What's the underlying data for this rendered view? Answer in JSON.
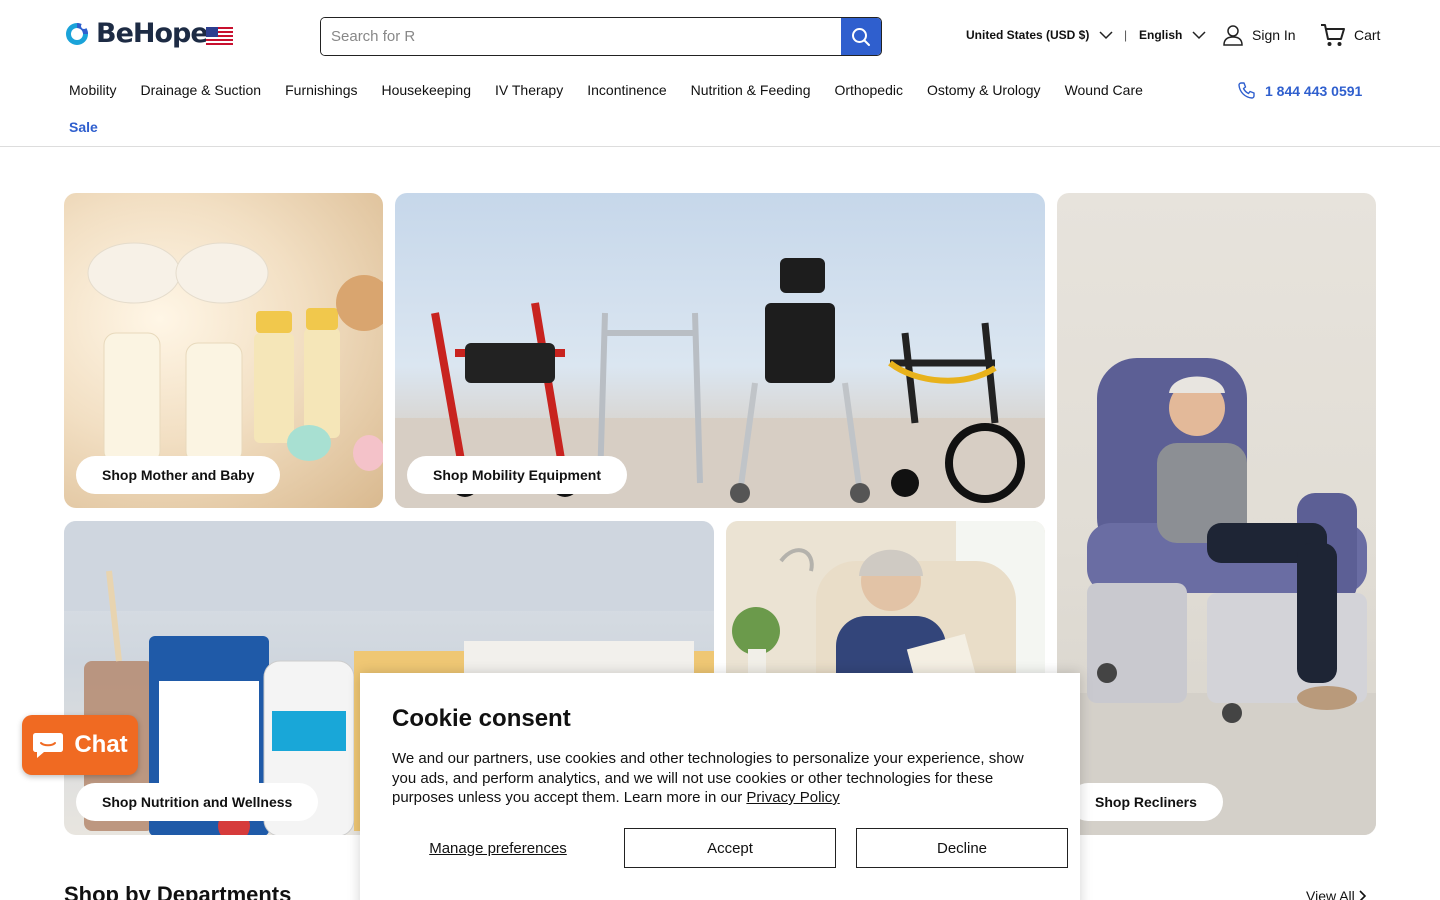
{
  "brand": {
    "name": "BeHope",
    "accent": "#2f5fce"
  },
  "header": {
    "search_placeholder": "Search for R",
    "country": "United States (USD $)",
    "separator": "|",
    "language": "English",
    "signin": "Sign In",
    "cart": "Cart"
  },
  "nav": {
    "items": [
      "Mobility",
      "Drainage & Suction",
      "Furnishings",
      "Housekeeping",
      "IV Therapy",
      "Incontinence",
      "Nutrition & Feeding",
      "Orthopedic",
      "Ostomy & Urology",
      "Wound Care"
    ],
    "sale": "Sale",
    "phone": "1 844 443 0591"
  },
  "tiles": {
    "mother_baby": "Shop Mother and Baby",
    "mobility": "Shop Mobility Equipment",
    "recliners": "Shop Recliners",
    "nutrition": "Shop Nutrition and Wellness"
  },
  "departments": {
    "title": "Shop by Departments",
    "view_all": "View All"
  },
  "chat": {
    "label": "Chat",
    "color": "#f06a22"
  },
  "cookie": {
    "title": "Cookie consent",
    "text": "We and our partners, use cookies and other technologies to personalize your experience, show you ads, and perform analytics, and we will not use cookies or other technologies for these purposes unless you accept them. Learn more in our",
    "policy_link": "Privacy Policy",
    "manage": "Manage preferences",
    "accept": "Accept",
    "decline": "Decline"
  }
}
